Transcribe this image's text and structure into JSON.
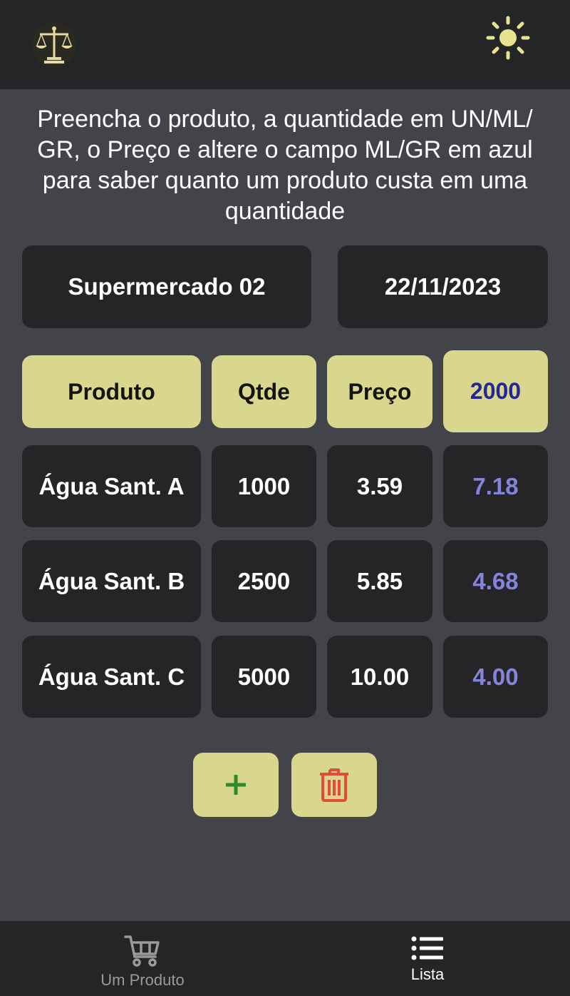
{
  "header": {
    "logo_icon": "scales-of-justice-icon",
    "theme_icon": "sun-icon"
  },
  "intro_text": "Preencha o produto, a quantidade em UN/ML/ GR, o Preço e altere o campo ML/GR em azul para saber quanto um produto custa em uma quantidade",
  "store_name": "Supermercado 02",
  "date": "22/11/2023",
  "table": {
    "headers": {
      "product": "Produto",
      "quantity": "Qtde",
      "price": "Preço",
      "reference_quantity": "2000"
    },
    "rows": [
      {
        "product": "Água Sant. A",
        "quantity": "1000",
        "price": "3.59",
        "result": "7.18"
      },
      {
        "product": "Água Sant. B",
        "quantity": "2500",
        "price": "5.85",
        "result": "4.68"
      },
      {
        "product": "Água Sant. C",
        "quantity": "5000",
        "price": "10.00",
        "result": "4.00"
      }
    ]
  },
  "actions": {
    "add_icon": "plus-icon",
    "delete_icon": "trash-icon"
  },
  "bottom_nav": {
    "items": [
      {
        "label": "Um Produto",
        "icon": "cart-icon",
        "active": false
      },
      {
        "label": "Lista",
        "icon": "list-icon",
        "active": true
      }
    ]
  },
  "colors": {
    "background": "#42444a",
    "bar": "#242526",
    "cell_dark": "#252527",
    "accent_yellow": "#d8d78d",
    "result_blue": "#8484dc",
    "reference_blue": "#25259a",
    "add_green": "#2e8b2e",
    "delete_red": "#e34a3a"
  }
}
